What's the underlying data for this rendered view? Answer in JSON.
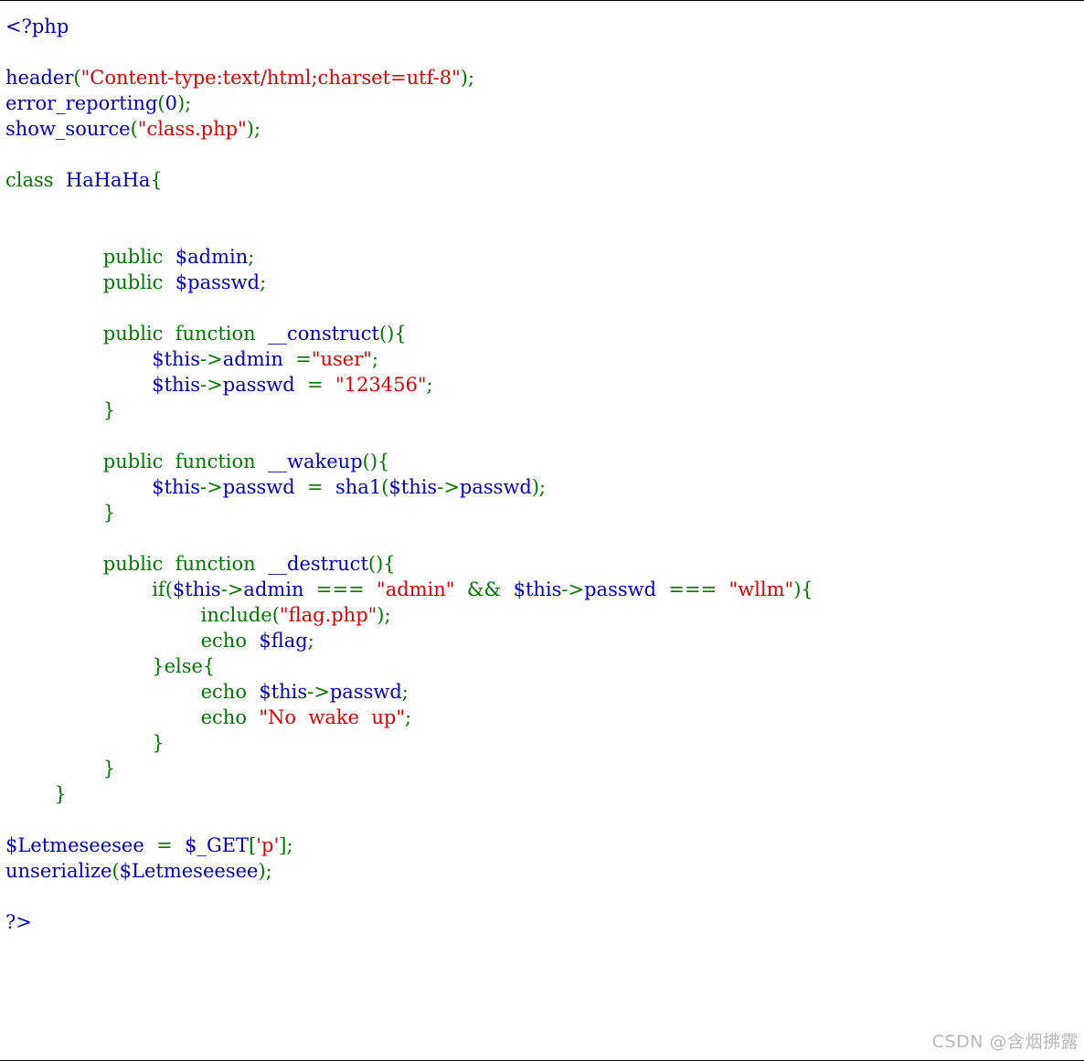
{
  "code": {
    "lines": [
      [
        {
          "t": "<?php",
          "k": "default"
        }
      ],
      [],
      [
        {
          "t": "header",
          "k": "default"
        },
        {
          "t": "(",
          "k": "keyword"
        },
        {
          "t": "\"Content-type:text/html;charset=utf-8\"",
          "k": "string"
        },
        {
          "t": ");",
          "k": "keyword"
        }
      ],
      [
        {
          "t": "error_reporting",
          "k": "default"
        },
        {
          "t": "(",
          "k": "keyword"
        },
        {
          "t": "0",
          "k": "default"
        },
        {
          "t": ");",
          "k": "keyword"
        }
      ],
      [
        {
          "t": "show_source",
          "k": "default"
        },
        {
          "t": "(",
          "k": "keyword"
        },
        {
          "t": "\"class.php\"",
          "k": "string"
        },
        {
          "t": ");",
          "k": "keyword"
        }
      ],
      [],
      [
        {
          "t": "class  ",
          "k": "keyword"
        },
        {
          "t": "HaHaHa",
          "k": "default"
        },
        {
          "t": "{",
          "k": "keyword"
        }
      ],
      [],
      [],
      [
        {
          "t": "                public  ",
          "k": "keyword"
        },
        {
          "t": "$admin",
          "k": "default"
        },
        {
          "t": ";",
          "k": "keyword"
        }
      ],
      [
        {
          "t": "                public  ",
          "k": "keyword"
        },
        {
          "t": "$passwd",
          "k": "default"
        },
        {
          "t": ";",
          "k": "keyword"
        }
      ],
      [],
      [
        {
          "t": "                public  function  ",
          "k": "keyword"
        },
        {
          "t": "__construct",
          "k": "default"
        },
        {
          "t": "(){",
          "k": "keyword"
        }
      ],
      [
        {
          "t": "                        ",
          "k": "keyword"
        },
        {
          "t": "$this",
          "k": "default"
        },
        {
          "t": "->",
          "k": "keyword"
        },
        {
          "t": "admin  ",
          "k": "default"
        },
        {
          "t": "=",
          "k": "keyword"
        },
        {
          "t": "\"user\"",
          "k": "string"
        },
        {
          "t": ";",
          "k": "keyword"
        }
      ],
      [
        {
          "t": "                        ",
          "k": "keyword"
        },
        {
          "t": "$this",
          "k": "default"
        },
        {
          "t": "->",
          "k": "keyword"
        },
        {
          "t": "passwd  ",
          "k": "default"
        },
        {
          "t": "=  ",
          "k": "keyword"
        },
        {
          "t": "\"123456\"",
          "k": "string"
        },
        {
          "t": ";",
          "k": "keyword"
        }
      ],
      [
        {
          "t": "                }",
          "k": "keyword"
        }
      ],
      [],
      [
        {
          "t": "                public  function  ",
          "k": "keyword"
        },
        {
          "t": "__wakeup",
          "k": "default"
        },
        {
          "t": "(){",
          "k": "keyword"
        }
      ],
      [
        {
          "t": "                        ",
          "k": "keyword"
        },
        {
          "t": "$this",
          "k": "default"
        },
        {
          "t": "->",
          "k": "keyword"
        },
        {
          "t": "passwd  ",
          "k": "default"
        },
        {
          "t": "=  ",
          "k": "keyword"
        },
        {
          "t": "sha1",
          "k": "default"
        },
        {
          "t": "(",
          "k": "keyword"
        },
        {
          "t": "$this",
          "k": "default"
        },
        {
          "t": "->",
          "k": "keyword"
        },
        {
          "t": "passwd",
          "k": "default"
        },
        {
          "t": ");",
          "k": "keyword"
        }
      ],
      [
        {
          "t": "                }",
          "k": "keyword"
        }
      ],
      [],
      [
        {
          "t": "                public  function  ",
          "k": "keyword"
        },
        {
          "t": "__destruct",
          "k": "default"
        },
        {
          "t": "(){",
          "k": "keyword"
        }
      ],
      [
        {
          "t": "                        if(",
          "k": "keyword"
        },
        {
          "t": "$this",
          "k": "default"
        },
        {
          "t": "->",
          "k": "keyword"
        },
        {
          "t": "admin  ",
          "k": "default"
        },
        {
          "t": "===  ",
          "k": "keyword"
        },
        {
          "t": "\"admin\"  ",
          "k": "string"
        },
        {
          "t": "&&  ",
          "k": "keyword"
        },
        {
          "t": "$this",
          "k": "default"
        },
        {
          "t": "->",
          "k": "keyword"
        },
        {
          "t": "passwd  ",
          "k": "default"
        },
        {
          "t": "===  ",
          "k": "keyword"
        },
        {
          "t": "\"wllm\"",
          "k": "string"
        },
        {
          "t": "){",
          "k": "keyword"
        }
      ],
      [
        {
          "t": "                                include(",
          "k": "keyword"
        },
        {
          "t": "\"flag.php\"",
          "k": "string"
        },
        {
          "t": ");",
          "k": "keyword"
        }
      ],
      [
        {
          "t": "                                echo  ",
          "k": "keyword"
        },
        {
          "t": "$flag",
          "k": "default"
        },
        {
          "t": ";",
          "k": "keyword"
        }
      ],
      [
        {
          "t": "                        }else{",
          "k": "keyword"
        }
      ],
      [
        {
          "t": "                                echo  ",
          "k": "keyword"
        },
        {
          "t": "$this",
          "k": "default"
        },
        {
          "t": "->",
          "k": "keyword"
        },
        {
          "t": "passwd",
          "k": "default"
        },
        {
          "t": ";",
          "k": "keyword"
        }
      ],
      [
        {
          "t": "                                echo  ",
          "k": "keyword"
        },
        {
          "t": "\"No  wake  up\"",
          "k": "string"
        },
        {
          "t": ";",
          "k": "keyword"
        }
      ],
      [
        {
          "t": "                        }",
          "k": "keyword"
        }
      ],
      [
        {
          "t": "                }",
          "k": "keyword"
        }
      ],
      [
        {
          "t": "        }",
          "k": "keyword"
        }
      ],
      [],
      [
        {
          "t": "$Letmeseesee  ",
          "k": "default"
        },
        {
          "t": "=  ",
          "k": "keyword"
        },
        {
          "t": "$_GET",
          "k": "default"
        },
        {
          "t": "[",
          "k": "keyword"
        },
        {
          "t": "'p'",
          "k": "string"
        },
        {
          "t": "];",
          "k": "keyword"
        }
      ],
      [
        {
          "t": "unserialize",
          "k": "default"
        },
        {
          "t": "(",
          "k": "keyword"
        },
        {
          "t": "$Letmeseesee",
          "k": "default"
        },
        {
          "t": ");",
          "k": "keyword"
        }
      ],
      [],
      [
        {
          "t": "?>",
          "k": "default"
        }
      ]
    ]
  },
  "watermark": "CSDN @含烟拂露",
  "colors": {
    "background": "#ffffff",
    "default": "#0000BB",
    "keyword": "#007700",
    "string": "#DD0000",
    "watermark": "#b8b8b8"
  }
}
